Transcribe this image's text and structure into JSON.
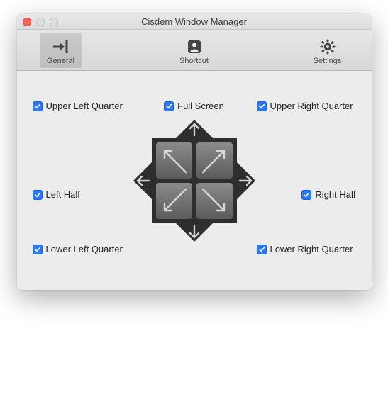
{
  "window": {
    "title": "Cisdem Window Manager"
  },
  "toolbar": {
    "items": [
      {
        "label": "General",
        "icon": "general-icon",
        "selected": true
      },
      {
        "label": "Shortcut",
        "icon": "shortcut-icon",
        "selected": false
      },
      {
        "label": "Settings",
        "icon": "settings-icon",
        "selected": false
      }
    ]
  },
  "options": {
    "upper_left": {
      "label": "Upper Left Quarter",
      "checked": true
    },
    "full_screen": {
      "label": "Full Screen",
      "checked": true
    },
    "upper_right": {
      "label": "Upper Right Quarter",
      "checked": true
    },
    "left_half": {
      "label": "Left Half",
      "checked": true
    },
    "right_half": {
      "label": "Right Half",
      "checked": true
    },
    "lower_left": {
      "label": "Lower Left Quarter",
      "checked": true
    },
    "lower_right": {
      "label": "Lower Right Quarter",
      "checked": true
    }
  },
  "colors": {
    "accent": "#2b79ff",
    "window_bg": "#ececec",
    "diagram_bg": "#2e2e2e"
  }
}
